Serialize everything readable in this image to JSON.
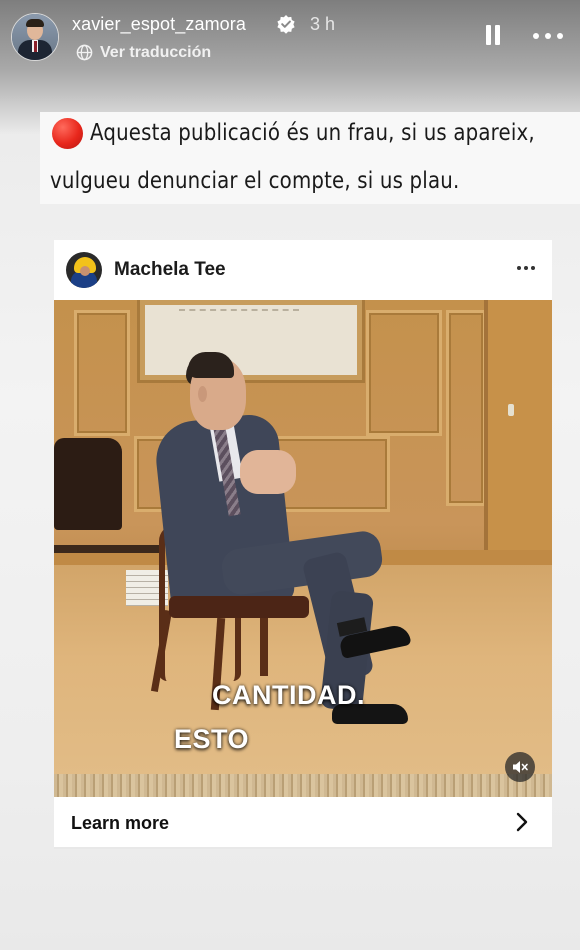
{
  "story": {
    "username": "xavier_espot_zamora",
    "verified": true,
    "time": "3 h",
    "translate_label": "Ver traducción"
  },
  "caption": {
    "line1": "Aquesta publicació és un frau, si us apareix,",
    "line2": "vulgueu denunciar el compte, si us plau.",
    "icon": "red-circle-icon"
  },
  "post": {
    "author": "Machela Tee",
    "video": {
      "subtitle_line1": "CANTIDAD.",
      "subtitle_line2": "ESTO",
      "muted": true
    },
    "cta_label": "Learn more"
  },
  "colors": {
    "warn_red": "#e8271c",
    "verified_blue": "#ffffff",
    "card_bg": "#ffffff"
  }
}
